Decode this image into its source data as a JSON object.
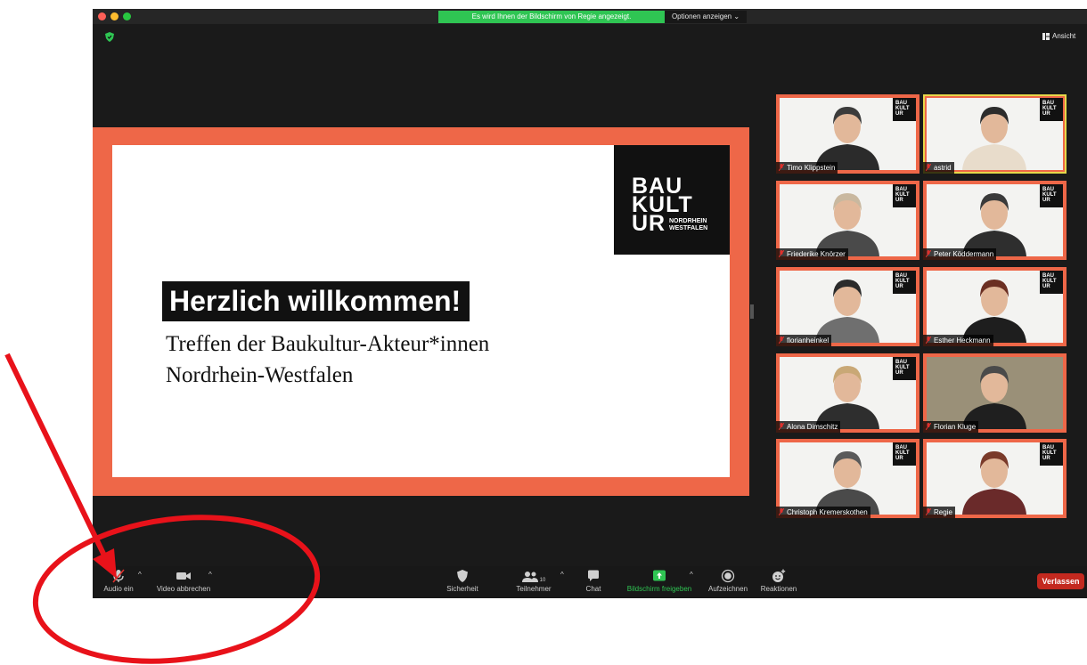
{
  "window": {
    "share_banner": "Es wird Ihnen der Bildschirm von Regie angezeigt.",
    "options_button": "Optionen anzeigen ⌄",
    "view_button": "Ansicht",
    "security_icon": "green-shield-icon"
  },
  "slide": {
    "logo_line1": "BAU",
    "logo_line2": "KULT",
    "logo_line3": "UR",
    "logo_sub1": "NORDRHEIN",
    "logo_sub2": "WESTFALEN",
    "headline": "Herzlich willkommen!",
    "subtitle_line1": "Treffen der Baukultur-Akteur*innen",
    "subtitle_line2": "Nordrhein-Westfalen"
  },
  "participants": [
    {
      "name": "Timo Klippstein"
    },
    {
      "name": "astrid"
    },
    {
      "name": "Friederike Knörzer"
    },
    {
      "name": "Peter Köddermann"
    },
    {
      "name": "florianheinkel"
    },
    {
      "name": "Esther Heckmann"
    },
    {
      "name": "Alona Dimschitz"
    },
    {
      "name": "Florian Kluge"
    },
    {
      "name": "Christoph Kremerskothen"
    },
    {
      "name": "Regie"
    }
  ],
  "toolbar": {
    "audio_label": "Audio ein",
    "video_label": "Video abbrechen",
    "security_label": "Sicherheit",
    "participants_label": "Teilnehmer",
    "participants_count": "10",
    "chat_label": "Chat",
    "share_label": "Bildschirm freigeben",
    "record_label": "Aufzeichnen",
    "reactions_label": "Reaktionen",
    "leave_label": "Verlassen"
  },
  "colors": {
    "accent_orange": "#ee6748",
    "share_green": "#2fc553",
    "leave_red": "#c3291f",
    "annotation_red": "#e8121a"
  }
}
